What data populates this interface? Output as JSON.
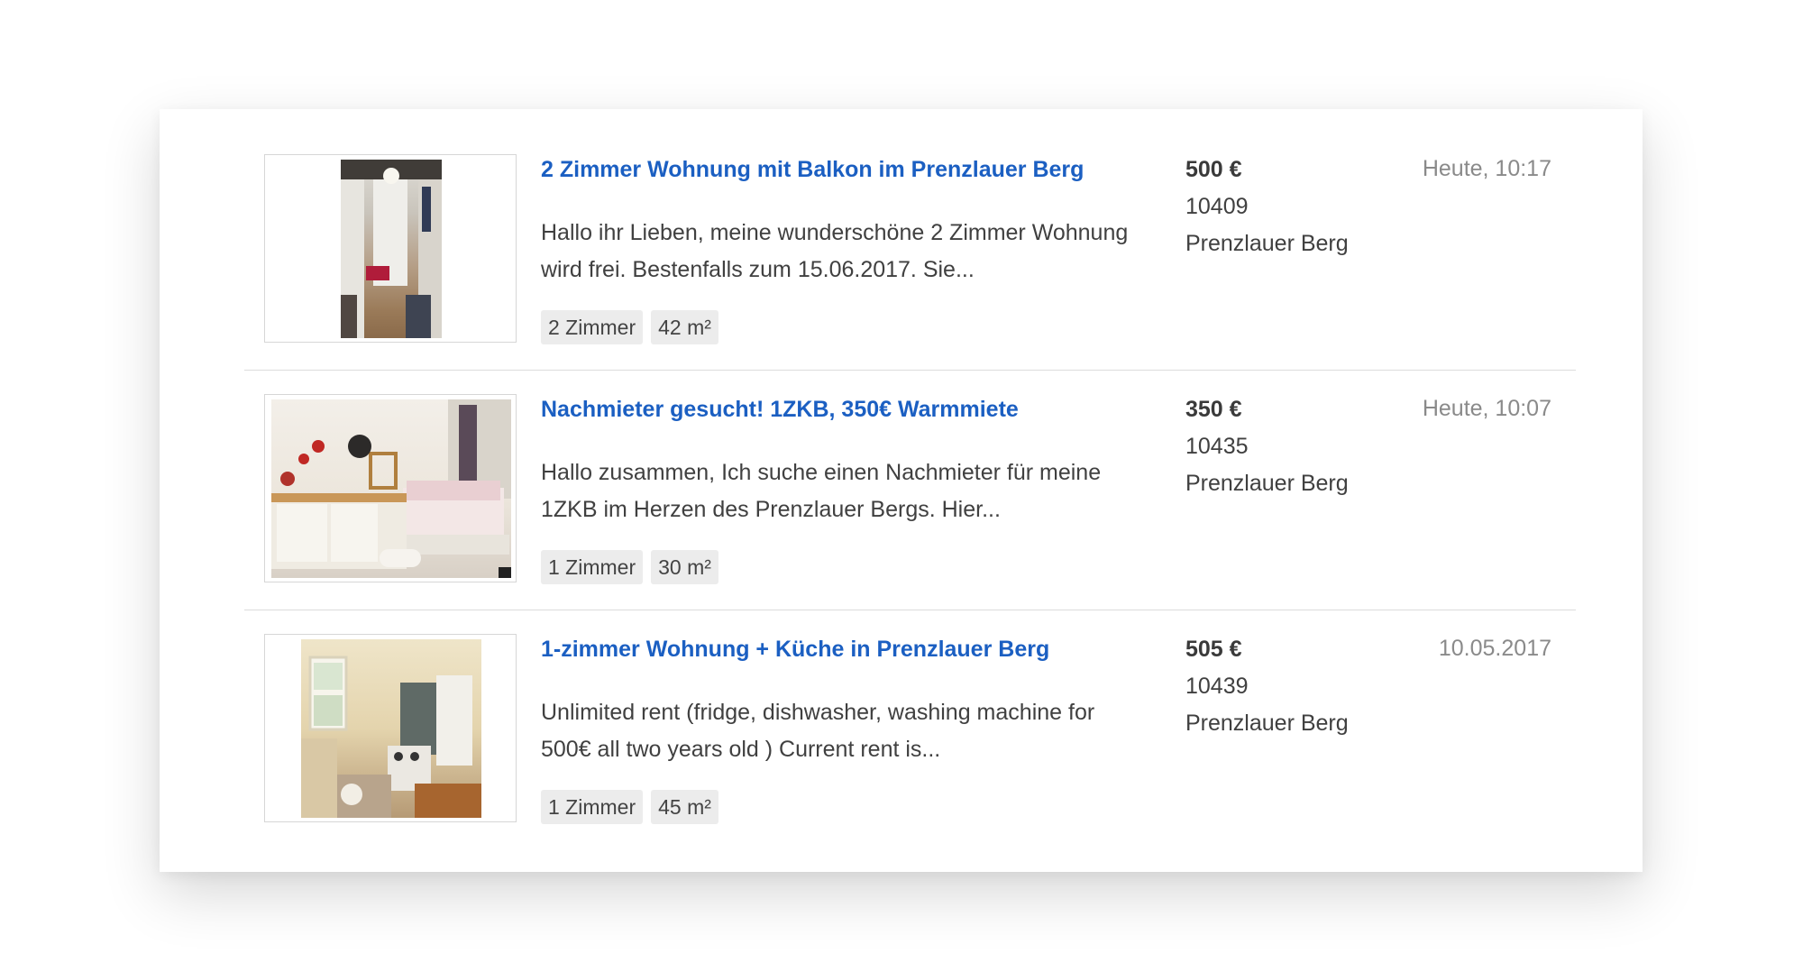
{
  "listings": [
    {
      "title": "2 Zimmer Wohnung mit Balkon im Prenzlauer Berg",
      "description_line1": "Hallo ihr Lieben, meine wunderschöne 2 Zimmer Wohnung",
      "description_line2": "wird frei. Bestenfalls zum 15.06.2017. Sie...",
      "rooms": "2 Zimmer",
      "size": "42 m²",
      "price": "500 €",
      "zip": "10409",
      "district": "Prenzlauer Berg",
      "date": "Heute, 10:17"
    },
    {
      "title": "Nachmieter gesucht! 1ZKB, 350€ Warmmiete",
      "description_line1": "Hallo zusammen, Ich suche einen Nachmieter für meine",
      "description_line2": "1ZKB im Herzen des Prenzlauer Bergs. Hier...",
      "rooms": "1 Zimmer",
      "size": "30 m²",
      "price": "350 €",
      "zip": "10435",
      "district": "Prenzlauer Berg",
      "date": "Heute, 10:07"
    },
    {
      "title": "1-zimmer Wohnung + Küche in Prenzlauer Berg",
      "description_line1": "Unlimited rent (fridge, dishwasher, washing machine for",
      "description_line2": "500€ all two years old ) Current rent is...",
      "rooms": "1 Zimmer",
      "size": "45 m²",
      "price": "505 €",
      "zip": "10439",
      "district": "Prenzlauer Berg",
      "date": "10.05.2017"
    }
  ],
  "colors": {
    "title_link": "#1b5fc2",
    "date_text": "#8a8a8a",
    "tag_background": "#ececec",
    "divider": "#dcdcdc"
  }
}
